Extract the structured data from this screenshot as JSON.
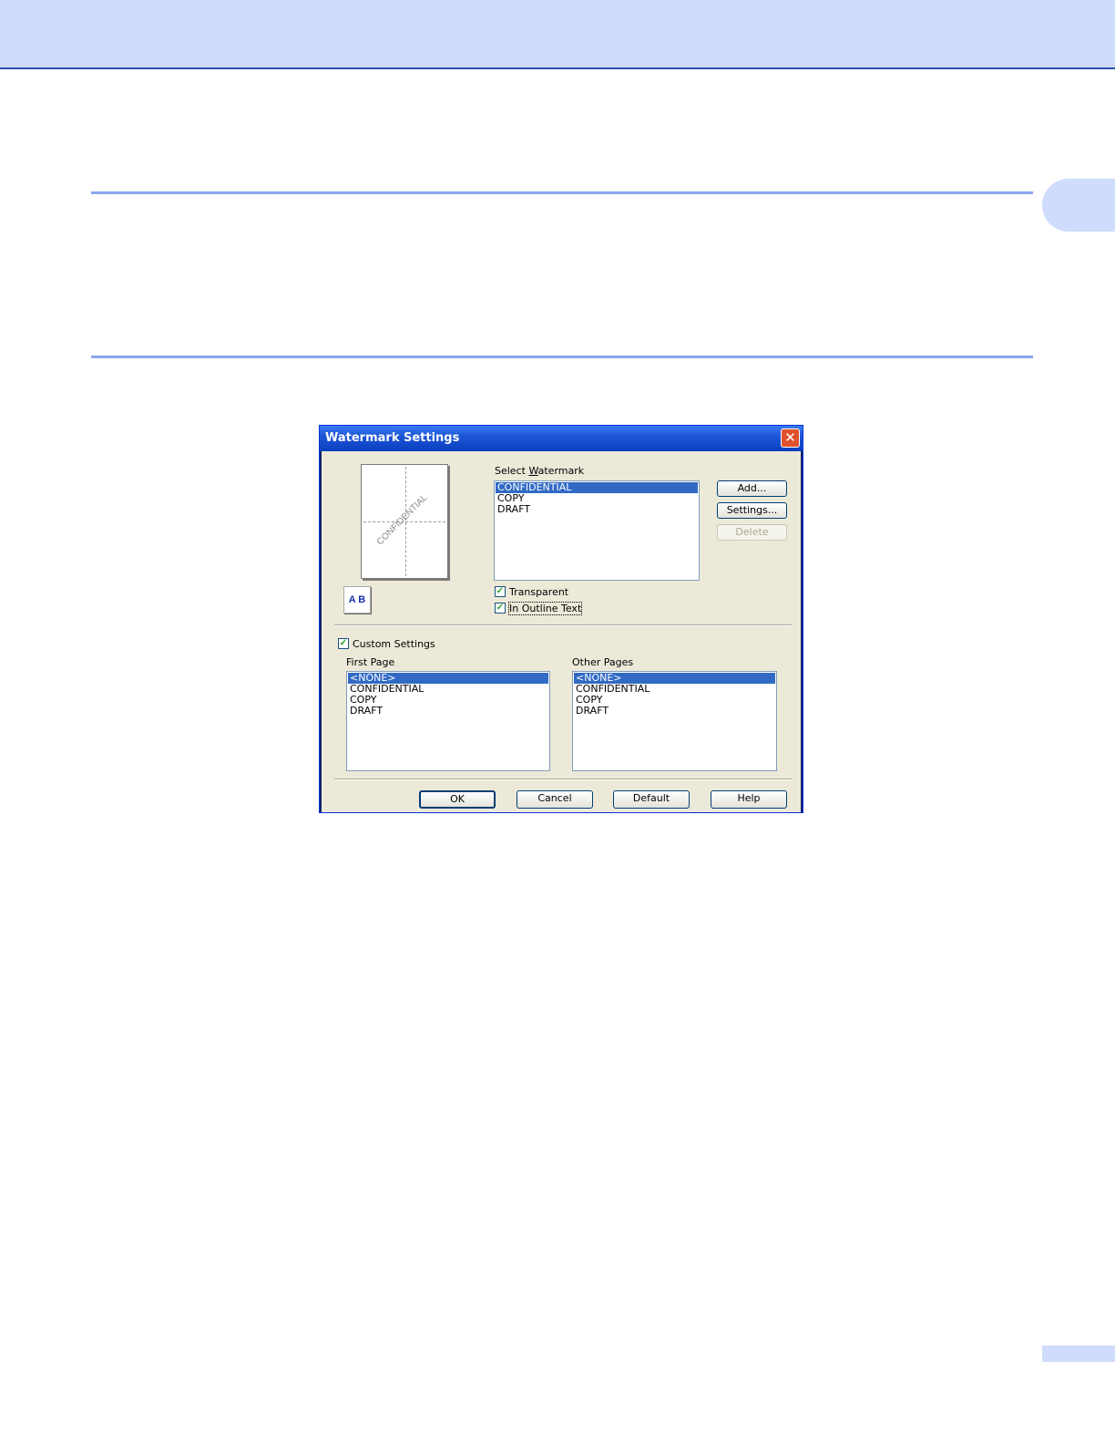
{
  "dialog": {
    "title": "Watermark Settings",
    "close_glyph": "✕",
    "preview_watermark": "CONFIDENTIAL",
    "ab_label": "A B",
    "select_label_pre": "Select ",
    "select_label_acc": "W",
    "select_label_post": "atermark",
    "watermarks": [
      "CONFIDENTIAL",
      "COPY",
      "DRAFT"
    ],
    "add_label": "Add...",
    "settings_label": "Settings...",
    "delete_label": "Delete",
    "transparent_label": "Transparent",
    "outline_label": "In Outline Text",
    "custom_label": "Custom Settings",
    "first_page_label": "First Page",
    "other_pages_label": "Other Pages",
    "first_page_items": [
      "<NONE>",
      "CONFIDENTIAL",
      "COPY",
      "DRAFT"
    ],
    "other_pages_items": [
      "<NONE>",
      "CONFIDENTIAL",
      "COPY",
      "DRAFT"
    ],
    "ok_label": "OK",
    "cancel_label": "Cancel",
    "default_label": "Default",
    "help_label": "Help",
    "check_glyph": "✓"
  }
}
